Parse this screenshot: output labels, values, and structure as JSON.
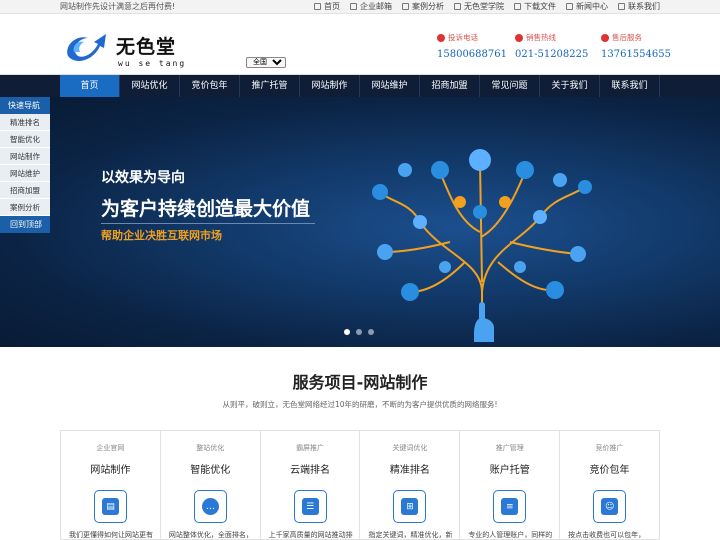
{
  "topbar": {
    "slogan": "网站制作先设计满意之后再付费!",
    "links": [
      {
        "label": "首页",
        "icon": "home-icon"
      },
      {
        "label": "企业邮箱",
        "icon": "mail-icon"
      },
      {
        "label": "案例分析",
        "icon": "case-icon"
      },
      {
        "label": "无色堂学院",
        "icon": "academy-icon"
      },
      {
        "label": "下载文件",
        "icon": "download-icon"
      },
      {
        "label": "新闻中心",
        "icon": "news-icon"
      },
      {
        "label": "联系我们",
        "icon": "contact-icon"
      }
    ]
  },
  "header": {
    "logo_cn": "无色堂",
    "logo_en": "wu se tang",
    "region": "全国",
    "contacts": [
      {
        "label": "投诉电话",
        "number": "15800688761"
      },
      {
        "label": "销售热线",
        "number": "021-51208225"
      },
      {
        "label": "售后服务",
        "number": "13761554655"
      }
    ]
  },
  "nav": {
    "items": [
      "首页",
      "网站优化",
      "竞价包年",
      "推广托管",
      "网站制作",
      "网站维护",
      "招商加盟",
      "常见问题",
      "关于我们",
      "联系我们"
    ],
    "active": 0
  },
  "banner": {
    "line1": "以效果为导向",
    "line2": "为客户持续创造最大价值",
    "line3": "帮助企业决胜互联网市场",
    "slides": 3,
    "active_slide": 0
  },
  "sidenav": {
    "head": "快速导航",
    "items": [
      "精准排名",
      "智能优化",
      "网站制作",
      "网站维护",
      "招商加盟",
      "案例分析"
    ],
    "foot": "回到顶部"
  },
  "services": {
    "title": "服务项目-网站制作",
    "desc": "从则平，破则立，无色堂网络经过10年的研磨，不断的为客户提供优质的网络服务!",
    "cards": [
      {
        "sub": "企业官网",
        "title": "网站制作",
        "icon": "website-icon",
        "text": "我们更懂得如何让网站更有"
      },
      {
        "sub": "整站优化",
        "title": "智能优化",
        "icon": "chat-icon",
        "text": "网站整体优化，全面排名，"
      },
      {
        "sub": "霸屏推广",
        "title": "云端排名",
        "icon": "server-icon",
        "text": "上千家高质量的网站推动排"
      },
      {
        "sub": "关键词优化",
        "title": "精准排名",
        "icon": "sitemap-icon",
        "text": "指定关键词，精准优化，新"
      },
      {
        "sub": "推广管理",
        "title": "账户托管",
        "icon": "document-icon",
        "text": "专业的人管理账户，同样的"
      },
      {
        "sub": "竞价推广",
        "title": "竞价包年",
        "icon": "users-icon",
        "text": "按点击收费也可以包年，"
      }
    ]
  },
  "colors": {
    "nav_bg": "#0f1e36",
    "nav_active": "#1a6cc2",
    "accent_blue": "#1565c0",
    "banner_highlight": "#f0a020",
    "contact_label": "#d9534f"
  }
}
